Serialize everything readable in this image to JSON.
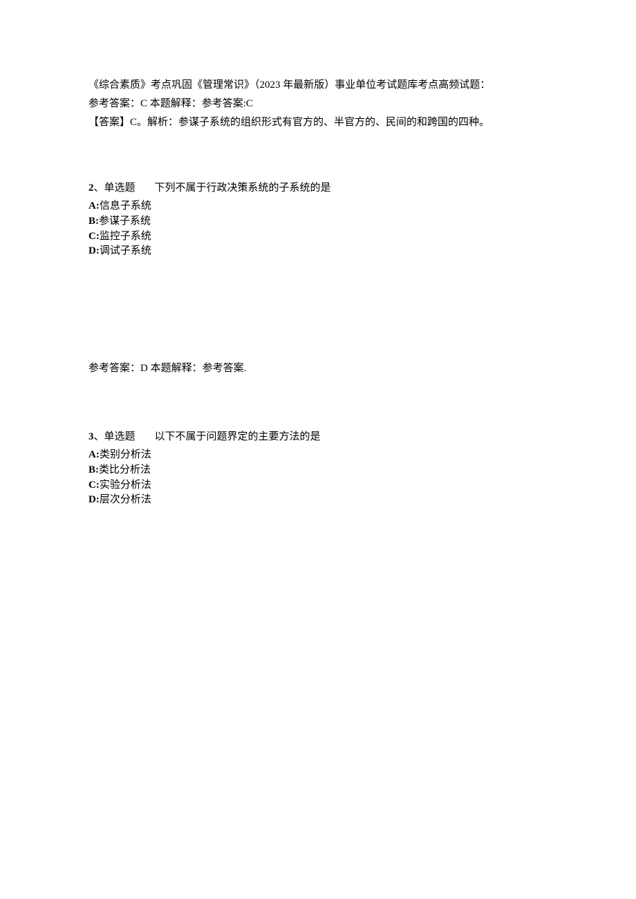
{
  "intro": {
    "line1": "《综合素质》考点巩固《管理常识》（2023 年最新版）事业单位考试题库考点高频试题：",
    "line2": "参考答案：C 本题解释：参考答案:C",
    "line3": "【答案】C。解析：参谋子系统的组织形式有官方的、半官方的、民间的和跨国的四种。"
  },
  "q2": {
    "number": "2",
    "sep": "、单选题",
    "text": "下列不属于行政决策系统的子系统的是",
    "optA_label": "A:",
    "optA_text": "信息子系统",
    "optB_label": "B:",
    "optB_text": "参谋子系统",
    "optC_label": "C:",
    "optC_text": "监控子系统",
    "optD_label": "D:",
    "optD_text": "调试子系统",
    "answer": "参考答案：D 本题解释：参考答案."
  },
  "q3": {
    "number": "3",
    "sep": "、单选题",
    "text": "以下不属于问题界定的主要方法的是",
    "optA_label": "A:",
    "optA_text": "类别分析法",
    "optB_label": "B:",
    "optB_text": "类比分析法",
    "optC_label": "C:",
    "optC_text": "实验分析法",
    "optD_label": "D:",
    "optD_text": "层次分析法"
  }
}
